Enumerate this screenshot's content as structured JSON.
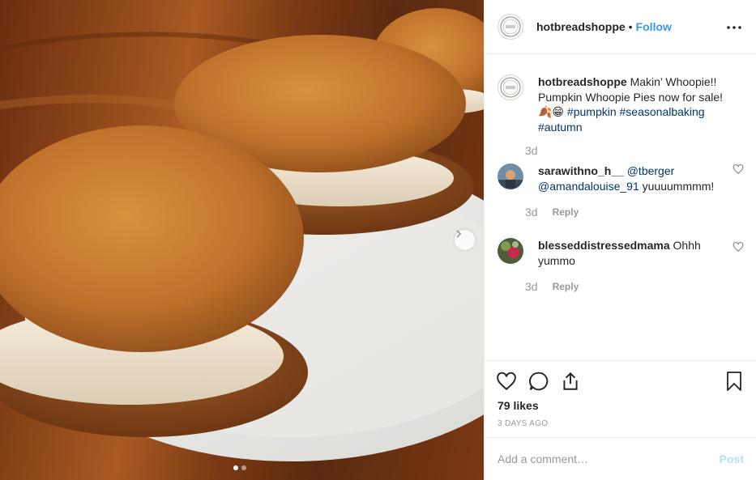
{
  "post": {
    "username": "hotbreadshoppe",
    "separator": "•",
    "follow_label": "Follow",
    "more_icon": "more-options-icon",
    "caption": {
      "username": "hotbreadshoppe",
      "text": "Makin’ Whoopie!! Pumpkin Whoopie Pies now for sale! 🍂😁",
      "hashtags": [
        "#pumpkin",
        "#seasonalbaking",
        "#autumn"
      ],
      "age": "3d"
    },
    "comments": [
      {
        "username": "sarawithno_h__",
        "mentions": [
          "@tberger",
          "@amandalouise_91"
        ],
        "text": "yuuuummmm!",
        "age": "3d",
        "reply_label": "Reply"
      },
      {
        "username": "blesseddistressedmama",
        "text": "Ohhh yummo",
        "age": "3d",
        "reply_label": "Reply"
      }
    ],
    "likes": "79 likes",
    "date": "3 DAYS AGO",
    "comment_placeholder": "Add a comment…",
    "post_label": "Post",
    "carousel": {
      "total": 2,
      "active": 1
    }
  },
  "colors": {
    "link": "#3897f0",
    "hashtag": "#003569",
    "muted": "#999999",
    "post_disabled": "#b2dffc"
  }
}
